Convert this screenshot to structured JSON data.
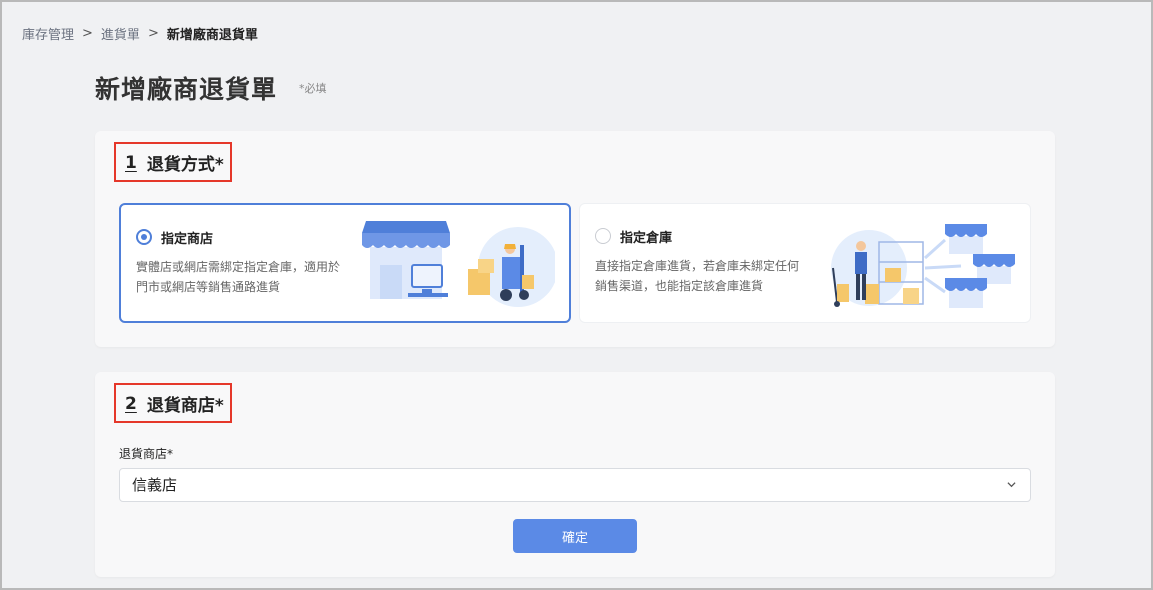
{
  "breadcrumb": {
    "items": [
      "庫存管理",
      "進貨單"
    ],
    "current": "新增廠商退貨單",
    "separator": ">"
  },
  "page": {
    "title": "新增廠商退貨單",
    "required_note": "*必填"
  },
  "section1": {
    "number": "1",
    "title": "退貨方式*",
    "options": [
      {
        "title": "指定商店",
        "description": "實體店或網店需綁定指定倉庫，適用於門市或網店等銷售通路進貨",
        "selected": true,
        "illustration": "storefront-forklift-icon"
      },
      {
        "title": "指定倉庫",
        "description": "直接指定倉庫進貨，若倉庫未綁定任何銷售渠道，也能指定該倉庫進貨",
        "selected": false,
        "illustration": "warehouse-stores-icon"
      }
    ]
  },
  "section2": {
    "number": "2",
    "title": "退貨商店*",
    "field_label": "退貨商店*",
    "select_value": "信義店",
    "confirm_label": "確定"
  },
  "colors": {
    "accent": "#4f7fd9",
    "button": "#5b8ae6",
    "highlight_border": "#e5372a",
    "background": "#f0f1f3"
  }
}
